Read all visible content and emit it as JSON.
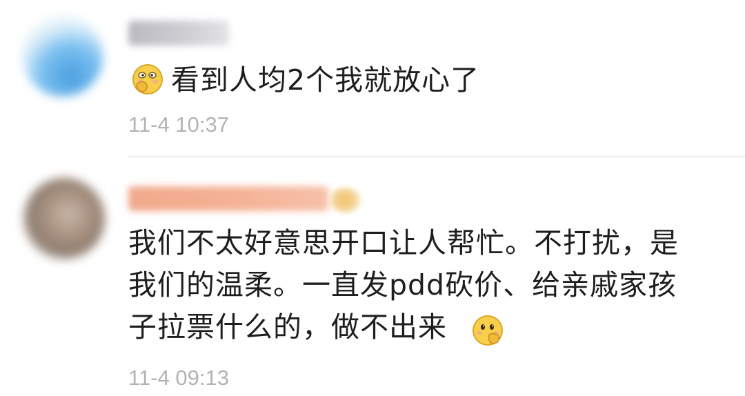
{
  "comments": [
    {
      "text": "看到人均2个我就放心了",
      "emoji": "shy-covering-mouth-emoji",
      "timestamp": "11-4 10:37"
    },
    {
      "lines": [
        "我们不太好意思开口让人帮忙。不打扰，是",
        "我们的温柔。一直发pdd砍价、给亲戚家孩",
        "子拉票什么的，做不出来"
      ],
      "emoji": "shy-covering-mouth-emoji",
      "timestamp": "11-4 09:13"
    }
  ],
  "colors": {
    "text": "#1e1e1e",
    "timestamp": "#b3b3b3",
    "divider": "#ececec",
    "emoji_face": "#f7cf4a"
  }
}
